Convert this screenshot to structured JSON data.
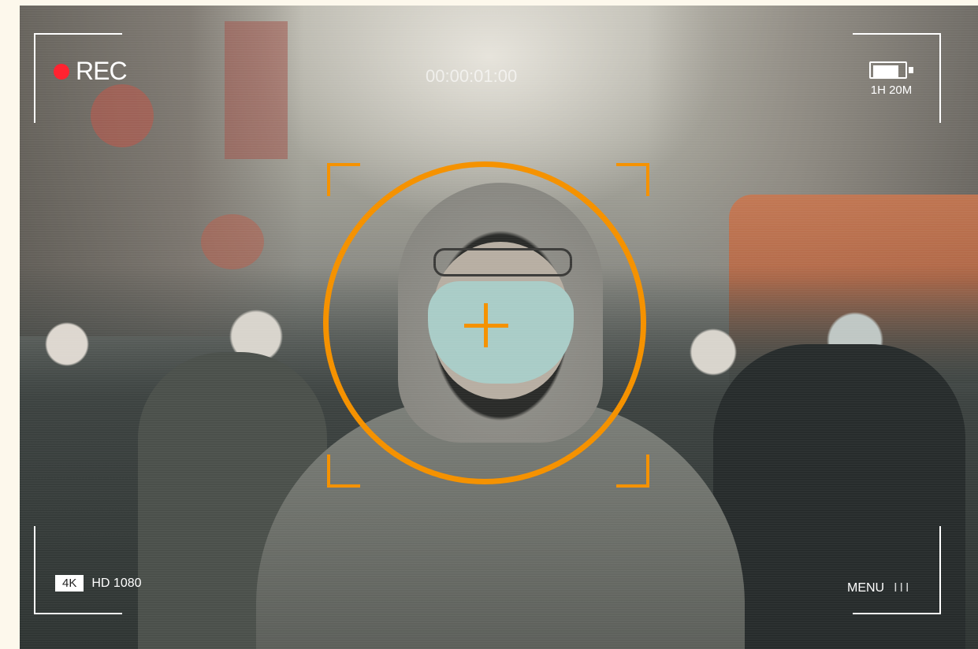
{
  "recording": {
    "indicator_label": "REC",
    "indicator_color": "#ff2330"
  },
  "timecode": "00:00:01:00",
  "battery": {
    "icon": "battery-icon",
    "level": 0.85,
    "time_remaining": "1H 20M"
  },
  "resolution": {
    "badge": "4K",
    "label": "HD 1080"
  },
  "menu": {
    "label": "MENU",
    "icon": "menu-bars-icon",
    "glyph": "III"
  },
  "focus": {
    "color": "#f59200",
    "icons": [
      "focus-ring-icon",
      "crosshair-icon",
      "focus-bracket-icon"
    ]
  },
  "scene": "camera-viewfinder-image"
}
